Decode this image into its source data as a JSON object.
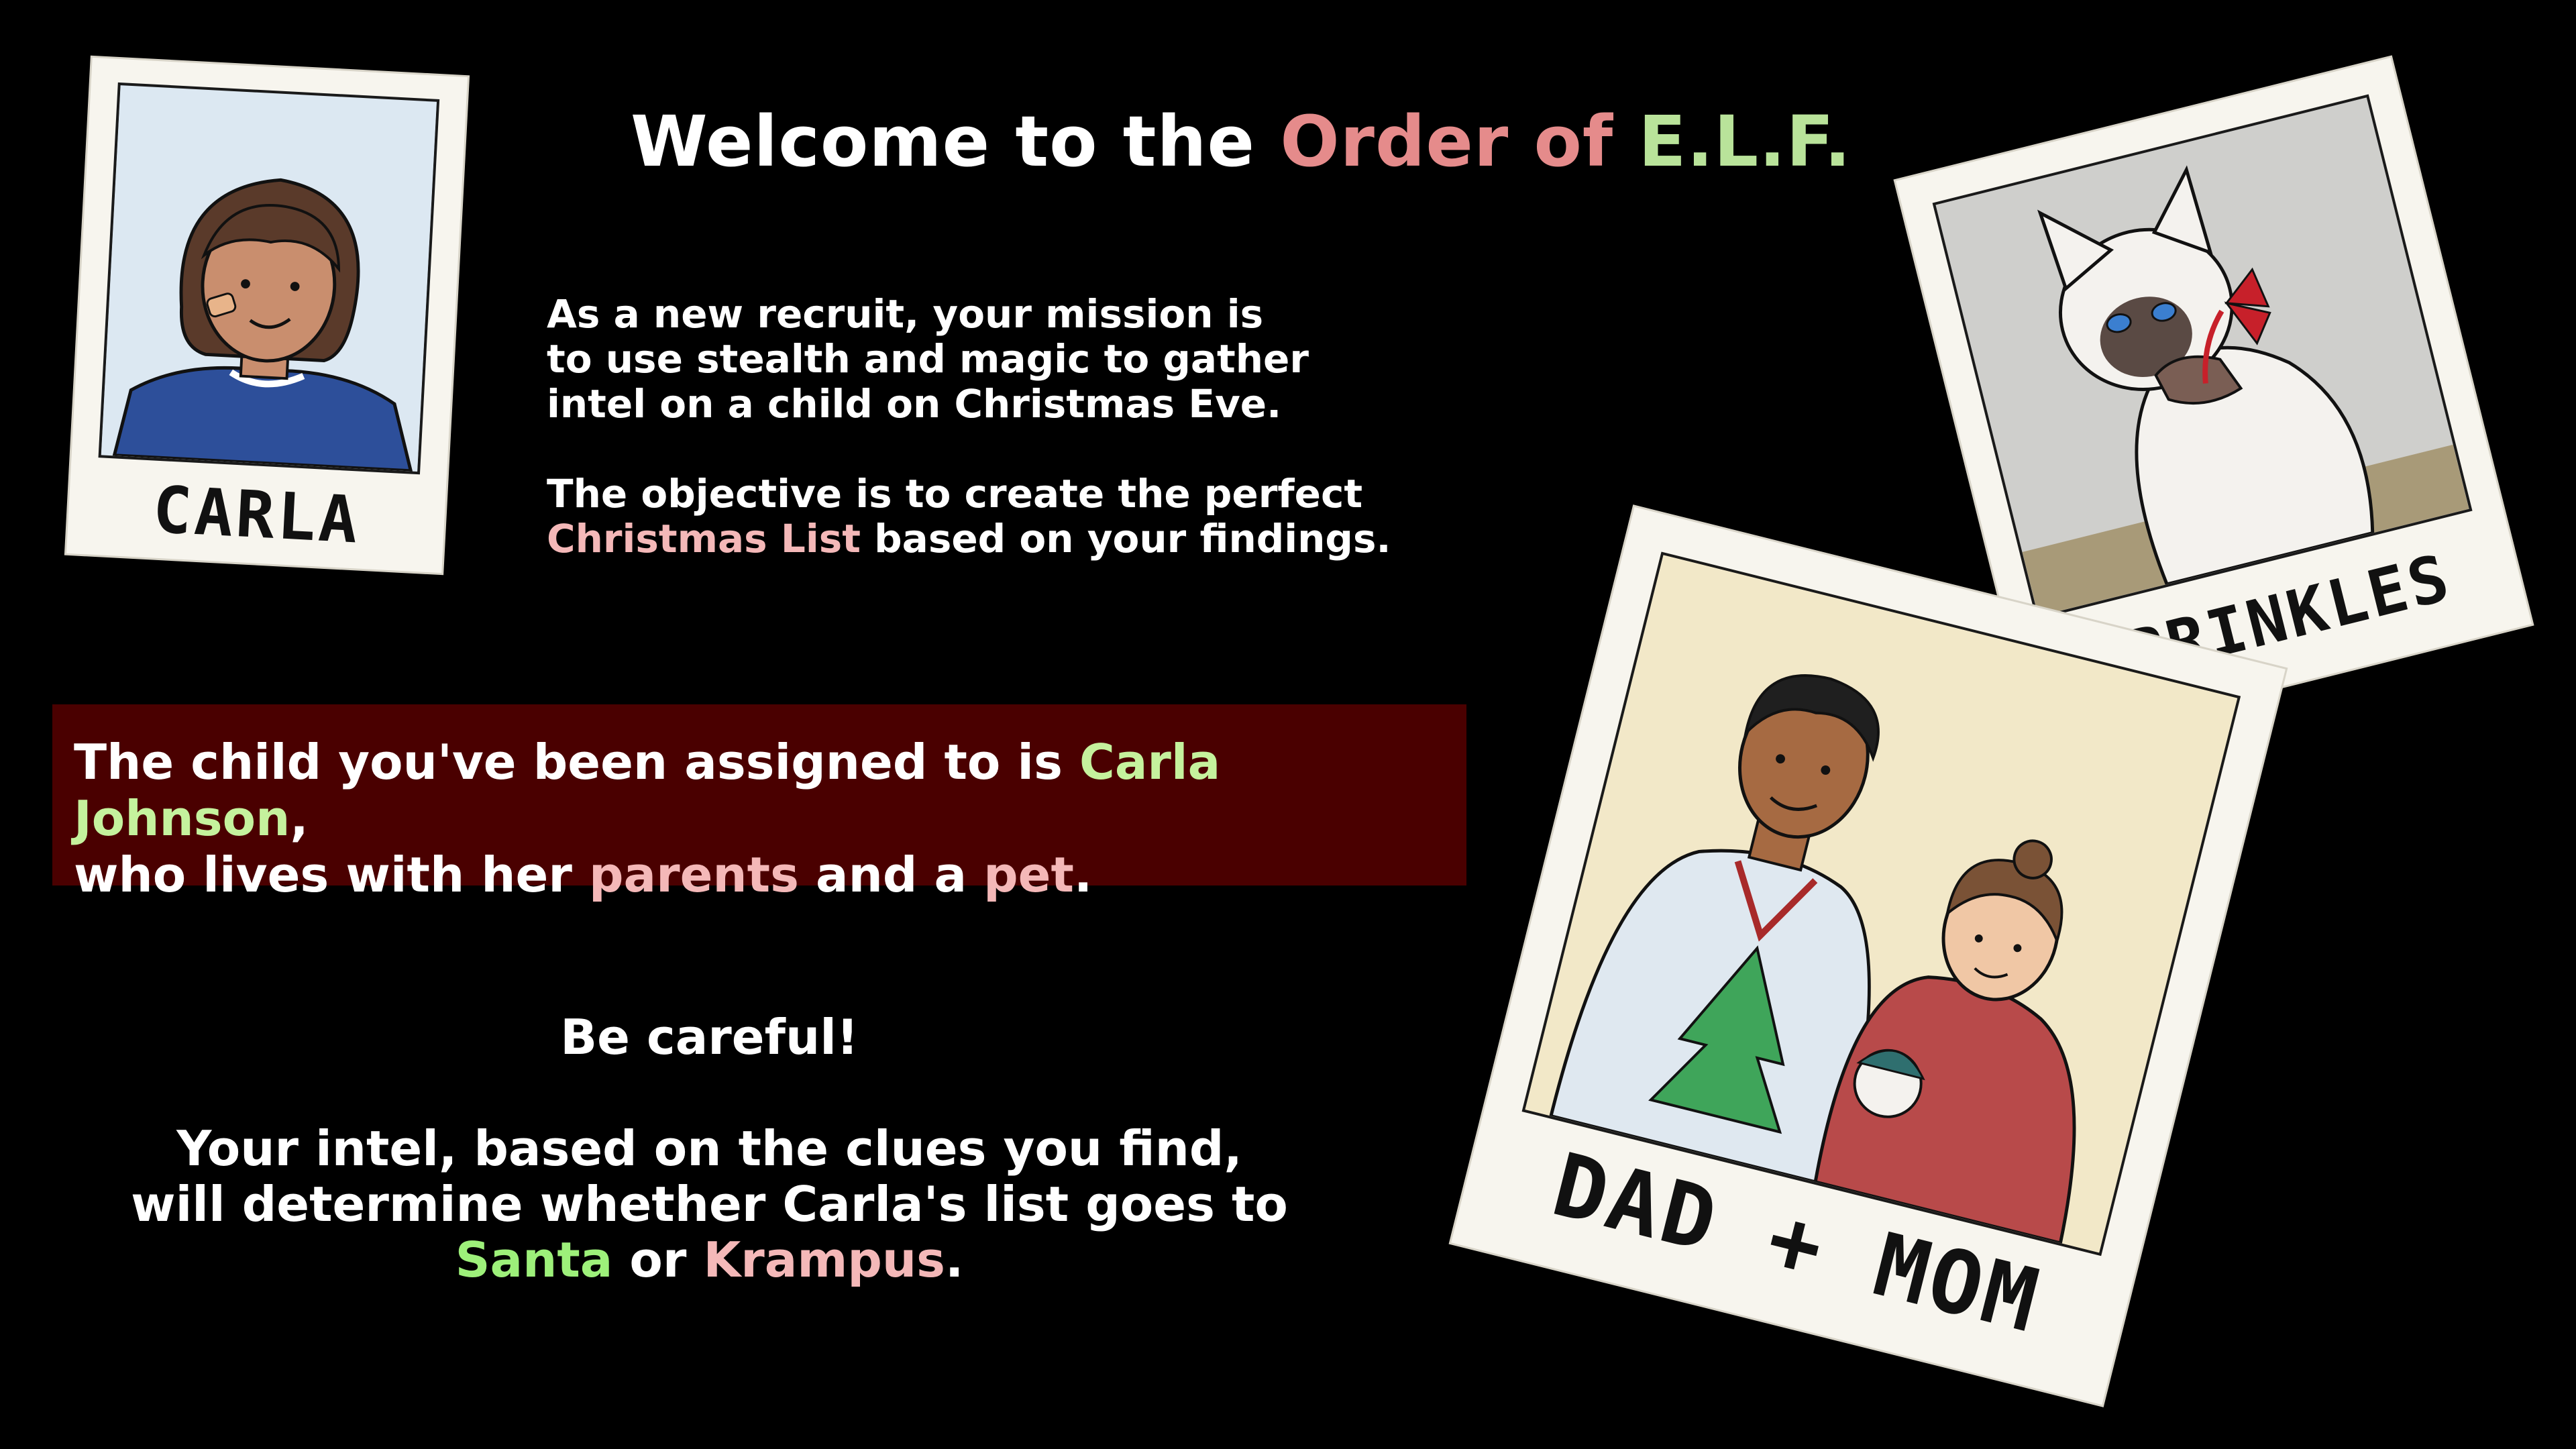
{
  "title": {
    "part1": "Welcome to the ",
    "part2": "Order of ",
    "part3": "E.L.F."
  },
  "intro": {
    "line1": "As a new recruit, your mission is",
    "line2": "to use stealth and magic to gather",
    "line3": "intel on a child on Christmas Eve.",
    "line4": "The objective is to create the perfect",
    "line5_highlight": "Christmas List",
    "line5_rest": " based on your findings."
  },
  "assignment": {
    "text1": "The child you've been assigned to is ",
    "child_name": "Carla Johnson",
    "text2": ",",
    "text3": "who lives with her ",
    "parents": "parents",
    "text4": " and a ",
    "pet": "pet",
    "text5": "."
  },
  "warning": {
    "heading": "Be careful!",
    "line1": "Your intel, based on the clues you find,",
    "line2": "will determine whether Carla's list goes to",
    "santa": "Santa",
    "or": " or ",
    "krampus": "Krampus",
    "end": "."
  },
  "photos": {
    "carla": "CARLA",
    "sprinkles": "SPRINKLES",
    "parents": "DAD + MOM"
  },
  "colors": {
    "background": "#000000",
    "order_of": "#e58b8b",
    "elf": "#b9e39a",
    "assignment_box": "#4a0000",
    "santa": "#9df07a",
    "krampus": "#f4b8b8"
  }
}
